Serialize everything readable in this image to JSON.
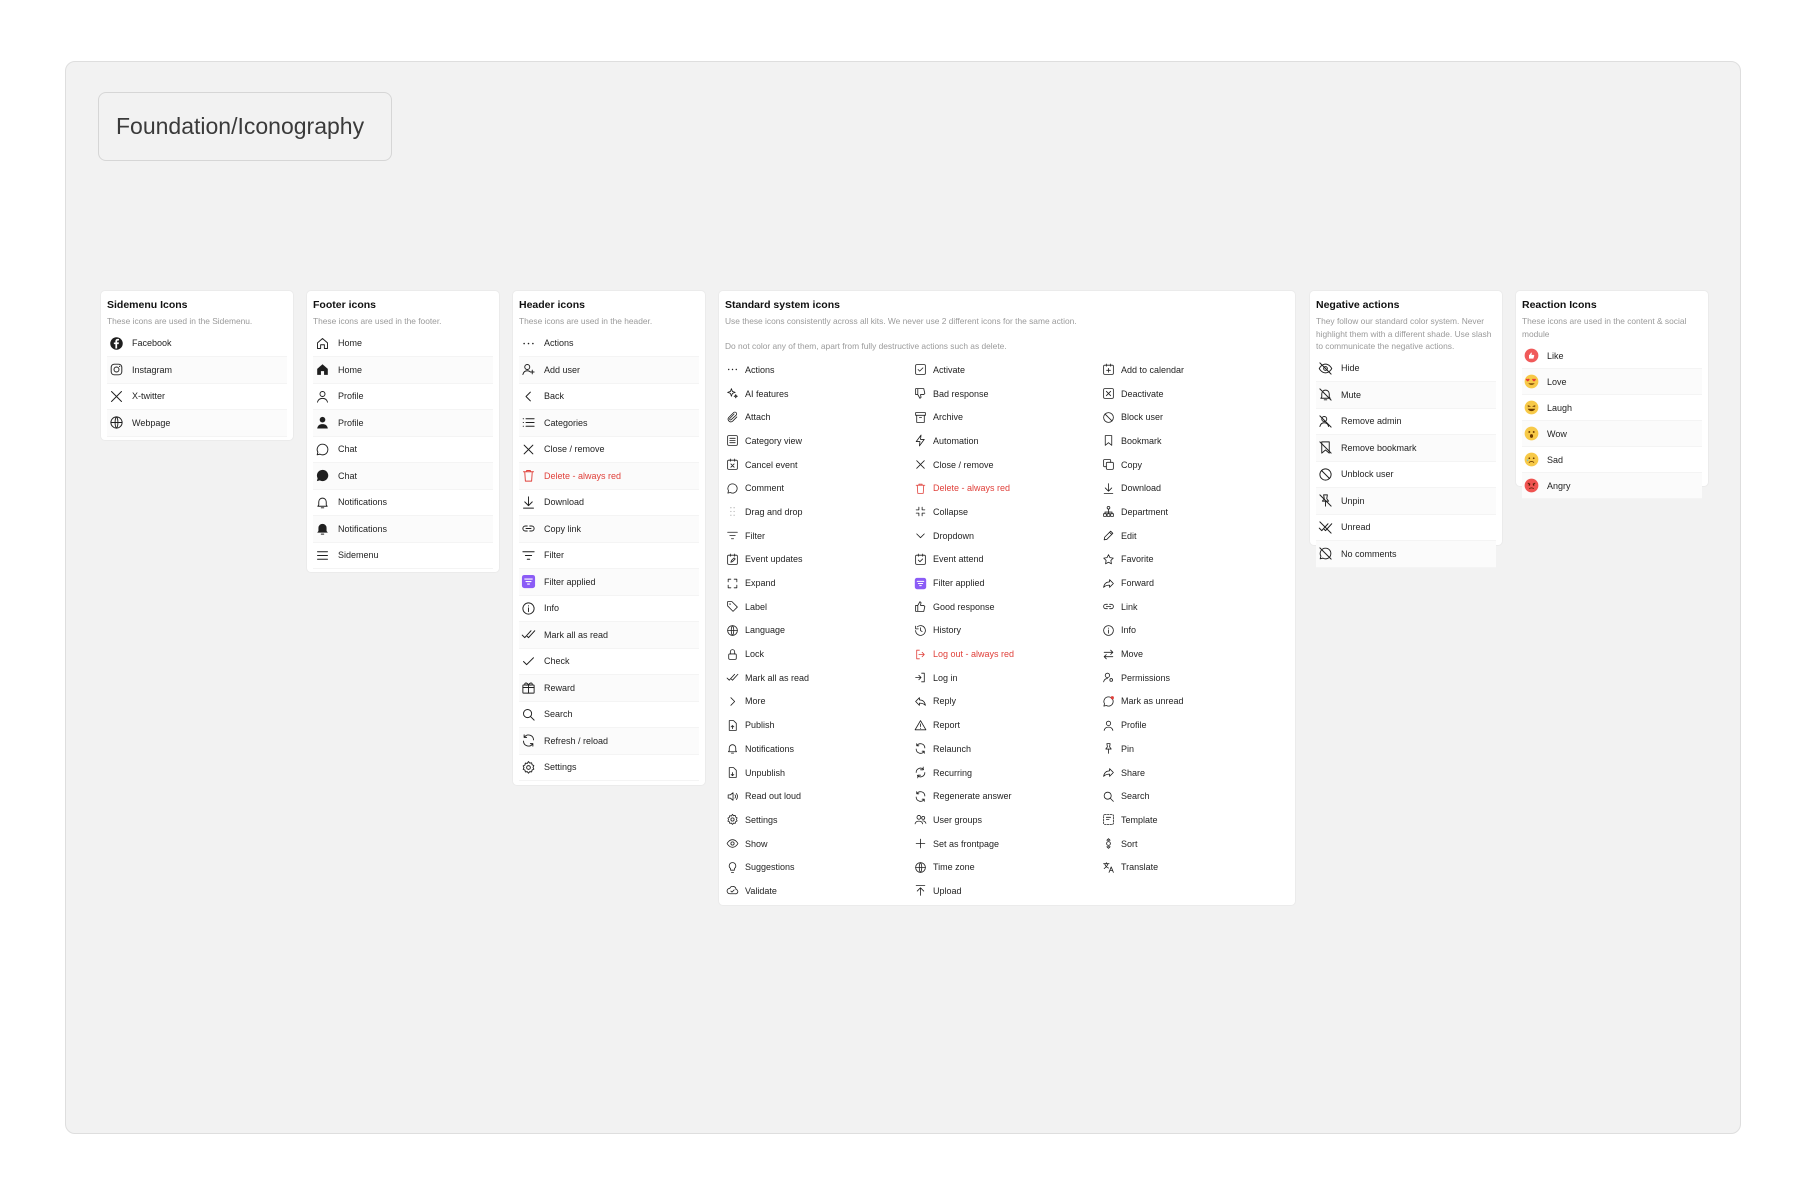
{
  "page_title": "Foundation/Iconography",
  "colors": {
    "red": "#e0413b",
    "accent": "#8b5cf6",
    "icon": "#1f1f1f"
  },
  "sidemenu": {
    "title": "Sidemenu Icons",
    "desc": "These icons are used in the Sidemenu.",
    "items": [
      {
        "label": "Facebook",
        "icon": "facebook"
      },
      {
        "label": "Instagram",
        "icon": "instagram"
      },
      {
        "label": "X-twitter",
        "icon": "x"
      },
      {
        "label": "Webpage",
        "icon": "globe"
      }
    ]
  },
  "footer": {
    "title": "Footer icons",
    "desc": "These icons are used in the footer.",
    "items": [
      {
        "label": "Home",
        "icon": "home"
      },
      {
        "label": "Home",
        "icon": "home-filled"
      },
      {
        "label": "Profile",
        "icon": "user"
      },
      {
        "label": "Profile",
        "icon": "user-filled"
      },
      {
        "label": "Chat",
        "icon": "chat"
      },
      {
        "label": "Chat",
        "icon": "chat-filled"
      },
      {
        "label": "Notifications",
        "icon": "bell"
      },
      {
        "label": "Notifications",
        "icon": "bell-filled"
      },
      {
        "label": "Sidemenu",
        "icon": "menu"
      }
    ]
  },
  "header": {
    "title": "Header icons",
    "desc": "These icons are used in the header.",
    "items": [
      {
        "label": "Actions",
        "icon": "dots"
      },
      {
        "label": "Add user",
        "icon": "user-plus"
      },
      {
        "label": "Back",
        "icon": "chevron-left"
      },
      {
        "label": "Categories",
        "icon": "list"
      },
      {
        "label": "Close / remove",
        "icon": "x-close"
      },
      {
        "label": "Delete - always red",
        "icon": "trash",
        "red": true
      },
      {
        "label": "Download",
        "icon": "download"
      },
      {
        "label": "Copy link",
        "icon": "link"
      },
      {
        "label": "Filter",
        "icon": "filter"
      },
      {
        "label": "Filter applied",
        "icon": "filter-applied"
      },
      {
        "label": "Info",
        "icon": "info"
      },
      {
        "label": "Mark all as read",
        "icon": "double-check"
      },
      {
        "label": "Check",
        "icon": "check"
      },
      {
        "label": "Reward",
        "icon": "gift"
      },
      {
        "label": "Search",
        "icon": "search"
      },
      {
        "label": "Refresh / reload",
        "icon": "refresh"
      },
      {
        "label": "Settings",
        "icon": "gear"
      }
    ]
  },
  "standard": {
    "title": "Standard system icons",
    "desc1": "Use these icons consistently across all kits. We never use 2 different icons for the same action.",
    "desc2": "Do not color any of them, apart from fully destructive actions such as delete.",
    "columns": [
      [
        {
          "label": "Actions",
          "icon": "dots"
        },
        {
          "label": "AI features",
          "icon": "sparkle"
        },
        {
          "label": "Attach",
          "icon": "paperclip"
        },
        {
          "label": "Category view",
          "icon": "list-box"
        },
        {
          "label": "Cancel event",
          "icon": "calendar-x"
        },
        {
          "label": "Comment",
          "icon": "chat"
        },
        {
          "label": "Drag and drop",
          "icon": "grip"
        },
        {
          "label": "Filter",
          "icon": "filter"
        },
        {
          "label": "Event updates",
          "icon": "calendar-edit"
        },
        {
          "label": "Expand",
          "icon": "expand"
        },
        {
          "label": "Label",
          "icon": "tag"
        },
        {
          "label": "Language",
          "icon": "globe"
        },
        {
          "label": "Lock",
          "icon": "lock"
        },
        {
          "label": "Mark all as read",
          "icon": "double-check"
        },
        {
          "label": "More",
          "icon": "chevron-right"
        },
        {
          "label": "Publish",
          "icon": "doc-up"
        },
        {
          "label": "Notifications",
          "icon": "bell"
        },
        {
          "label": "Unpublish",
          "icon": "doc-down"
        },
        {
          "label": "Read out loud",
          "icon": "speaker"
        },
        {
          "label": "Settings",
          "icon": "gear"
        },
        {
          "label": "Show",
          "icon": "eye"
        },
        {
          "label": "Suggestions",
          "icon": "bulb"
        },
        {
          "label": "Validate",
          "icon": "cloud-check"
        }
      ],
      [
        {
          "label": "Activate",
          "icon": "check-box"
        },
        {
          "label": "Bad response",
          "icon": "thumb-down"
        },
        {
          "label": "Archive",
          "icon": "archive"
        },
        {
          "label": "Automation",
          "icon": "bolt"
        },
        {
          "label": "Close / remove",
          "icon": "x-close"
        },
        {
          "label": "Delete - always red",
          "icon": "trash",
          "red": true
        },
        {
          "label": "Collapse",
          "icon": "collapse"
        },
        {
          "label": "Dropdown",
          "icon": "chevron-down"
        },
        {
          "label": "Event attend",
          "icon": "calendar-check"
        },
        {
          "label": "Filter applied",
          "icon": "filter-applied"
        },
        {
          "label": "Good response",
          "icon": "thumb-up"
        },
        {
          "label": "History",
          "icon": "history"
        },
        {
          "label": "Log out - always red",
          "icon": "logout",
          "red": true
        },
        {
          "label": "Log in",
          "icon": "login"
        },
        {
          "label": "Reply",
          "icon": "reply"
        },
        {
          "label": "Report",
          "icon": "warning"
        },
        {
          "label": "Relaunch",
          "icon": "refresh"
        },
        {
          "label": "Recurring",
          "icon": "repeat"
        },
        {
          "label": "Regenerate answer",
          "icon": "refresh"
        },
        {
          "label": "User groups",
          "icon": "users"
        },
        {
          "label": "Set as frontpage",
          "icon": "plus"
        },
        {
          "label": "Time zone",
          "icon": "globe"
        },
        {
          "label": "Upload",
          "icon": "upload"
        }
      ],
      [
        {
          "label": "Add to calendar",
          "icon": "calendar-plus"
        },
        {
          "label": "Deactivate",
          "icon": "x-box"
        },
        {
          "label": "Block user",
          "icon": "block"
        },
        {
          "label": "Bookmark",
          "icon": "bookmark"
        },
        {
          "label": "Copy",
          "icon": "copy"
        },
        {
          "label": "Download",
          "icon": "download"
        },
        {
          "label": "Department",
          "icon": "org"
        },
        {
          "label": "Edit",
          "icon": "pencil"
        },
        {
          "label": "Favorite",
          "icon": "star"
        },
        {
          "label": "Forward",
          "icon": "forward"
        },
        {
          "label": "Link",
          "icon": "link"
        },
        {
          "label": "Info",
          "icon": "info"
        },
        {
          "label": "Move",
          "icon": "move"
        },
        {
          "label": "Permissions",
          "icon": "user-key"
        },
        {
          "label": "Mark as unread",
          "icon": "chat-dot"
        },
        {
          "label": "Profile",
          "icon": "user"
        },
        {
          "label": "Pin",
          "icon": "pin"
        },
        {
          "label": "Share",
          "icon": "share"
        },
        {
          "label": "Search",
          "icon": "search"
        },
        {
          "label": "Template",
          "icon": "template"
        },
        {
          "label": "Sort",
          "icon": "sort"
        },
        {
          "label": "Translate",
          "icon": "translate"
        }
      ]
    ]
  },
  "negative": {
    "title": "Negative actions",
    "desc": "They follow our standard color system. Never highlight them with a different shade. Use slash to communicate the negative actions.",
    "items": [
      {
        "label": "Hide",
        "icon": "eye-off"
      },
      {
        "label": "Mute",
        "icon": "bell-off"
      },
      {
        "label": "Remove admin",
        "icon": "admin-off"
      },
      {
        "label": "Remove bookmark",
        "icon": "bookmark-off"
      },
      {
        "label": "Unblock user",
        "icon": "block"
      },
      {
        "label": "Unpin",
        "icon": "pin-off"
      },
      {
        "label": "Unread",
        "icon": "check-off"
      },
      {
        "label": "No comments",
        "icon": "chat-off"
      }
    ]
  },
  "reactions": {
    "title": "Reaction Icons",
    "desc": "These icons are used in the content & social module",
    "items": [
      {
        "label": "Like",
        "emoji": "like",
        "color": "#f05a5a"
      },
      {
        "label": "Love",
        "emoji": "love",
        "color": "#f7b733"
      },
      {
        "label": "Laugh",
        "emoji": "laugh",
        "color": "#f7c948"
      },
      {
        "label": "Wow",
        "emoji": "wow",
        "color": "#f7c948"
      },
      {
        "label": "Sad",
        "emoji": "sad",
        "color": "#f7c948"
      },
      {
        "label": "Angry",
        "emoji": "angry",
        "color": "#ef5350"
      }
    ]
  }
}
